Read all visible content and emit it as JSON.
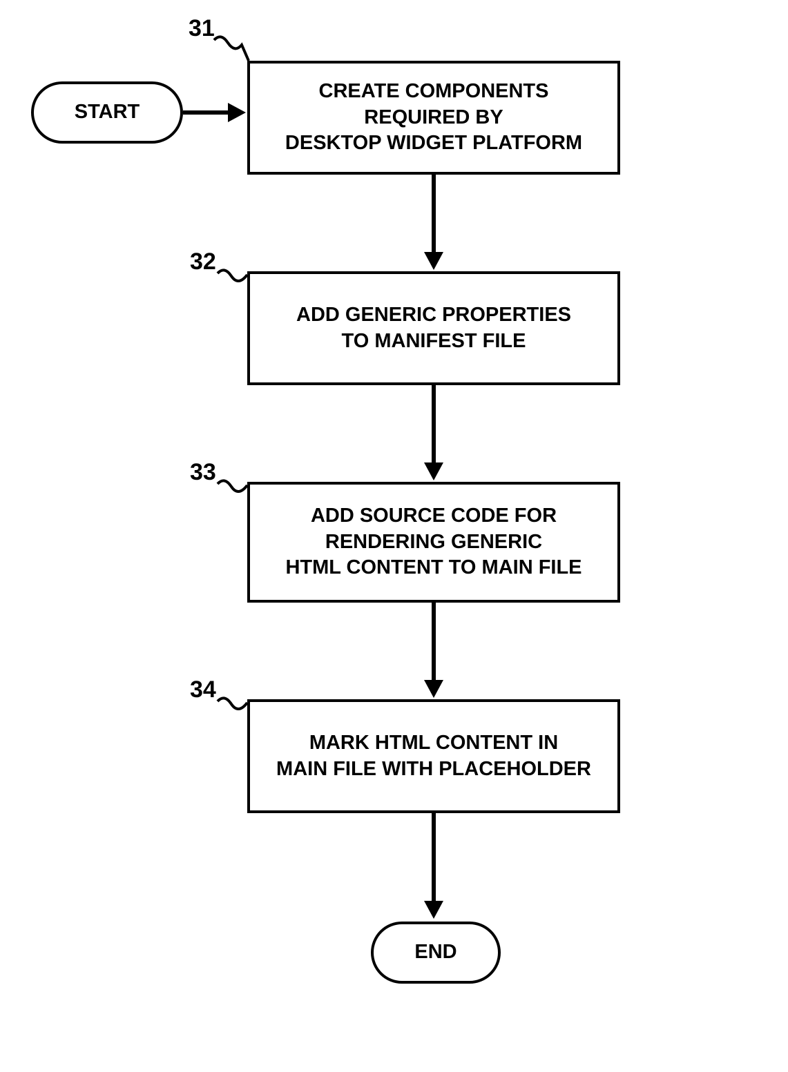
{
  "terminals": {
    "start": "START",
    "end": "END"
  },
  "steps": {
    "step31": {
      "label": "31",
      "text": "CREATE COMPONENTS\nREQUIRED BY\nDESKTOP WIDGET PLATFORM"
    },
    "step32": {
      "label": "32",
      "text": "ADD GENERIC PROPERTIES\nTO MANIFEST FILE"
    },
    "step33": {
      "label": "33",
      "text": "ADD SOURCE CODE FOR\nRENDERING GENERIC\nHTML CONTENT TO MAIN FILE"
    },
    "step34": {
      "label": "34",
      "text": "MARK HTML CONTENT IN\nMAIN FILE WITH PLACEHOLDER"
    }
  }
}
